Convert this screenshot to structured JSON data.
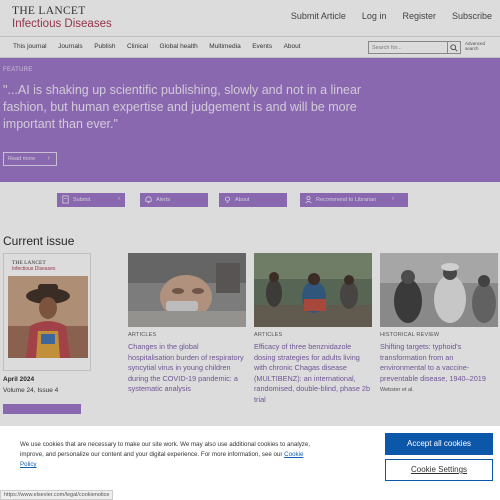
{
  "brand": {
    "line1": "THE LANCET",
    "line2": "Infectious Diseases"
  },
  "top_links": [
    "Submit Article",
    "Log in",
    "Register",
    "Subscribe"
  ],
  "nav": [
    "This journal",
    "Journals",
    "Publish",
    "Clinical",
    "Global health",
    "Multimedia",
    "Events",
    "About"
  ],
  "search": {
    "placeholder": "Search for...",
    "advanced": "Advanced search"
  },
  "feature": {
    "tag": "FEATURE",
    "quote": "\"...AI is shaking up scientific publishing, slowly and not in a linear fashion, but human expertise and judgement is and will be more important than ever.\"",
    "read_more": "Read more"
  },
  "actions": [
    {
      "label": "Submit",
      "icon": "document-icon"
    },
    {
      "label": "Alerts",
      "icon": "bell-icon"
    },
    {
      "label": "About",
      "icon": "lightbulb-icon"
    },
    {
      "label": "Recommend to Librarian",
      "icon": "person-icon"
    }
  ],
  "current_issue": {
    "heading": "Current issue",
    "cover_brand_1": "THE LANCET",
    "cover_brand_2": "Infectious Diseases",
    "date": "April 2024",
    "volume": "Volume 24, Issue 4"
  },
  "articles": [
    {
      "tag": "ARTICLES",
      "title": "Changes in the global hospitalisation burden of respiratory syncytial virus in young children during the COVID-19 pandemic: a systematic analysis",
      "author": ""
    },
    {
      "tag": "ARTICLES",
      "title": "Efficacy of three benznidazole dosing strategies for adults living with chronic Chagas disease (MULTIBENZ): an international, randomised, double-blind, phase 2b trial",
      "author": ""
    },
    {
      "tag": "HISTORICAL REVIEW",
      "title": "Shifting targets: typhoid's transformation from an environmental to a vaccine-preventable disease, 1940–2019",
      "author": "Webster et al."
    }
  ],
  "cookie": {
    "text": "We use cookies that are necessary to make our site work. We may also use additional cookies to analyze, improve, and personalize our content and your digital experience. For more information, see our ",
    "link": "Cookie Policy",
    "accept": "Accept all cookies",
    "settings": "Cookie Settings"
  },
  "status_url": "https://www.elsevier.com/legal/cookienotice",
  "colors": {
    "accent_purple": "#9b72c8",
    "brand_red": "#a8324d",
    "button_blue": "#0d57ab"
  }
}
